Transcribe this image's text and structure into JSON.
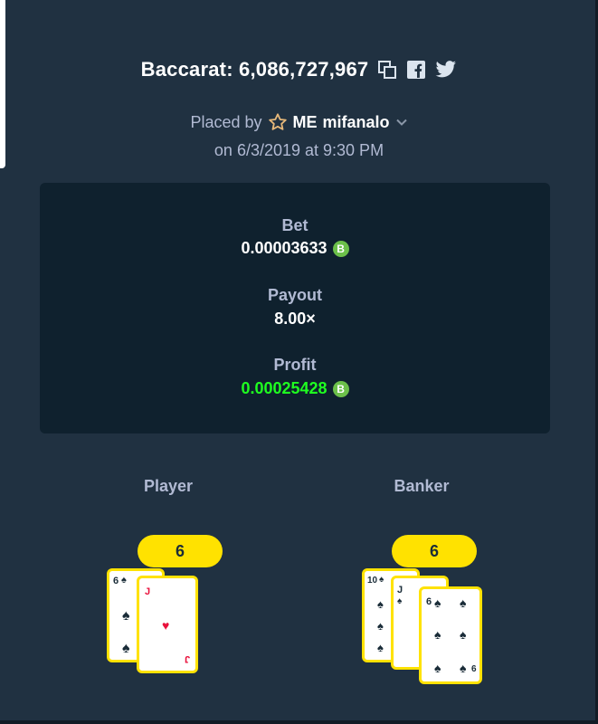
{
  "bet_info": {
    "title": "Baccarat: 6,086,727,967",
    "placed_by_label": "Placed by",
    "user_badge": "ME",
    "username": "mifanalo",
    "date_line": "on 6/3/2019 at 9:30 PM"
  },
  "stats": {
    "bet_label": "Bet",
    "bet_value": "0.00003633",
    "payout_label": "Payout",
    "payout_value": "8.00×",
    "profit_label": "Profit",
    "profit_value": "0.00025428",
    "coin_symbol": "B",
    "coin_color": "#6cc04a",
    "profit_color": "#1fff20"
  },
  "player": {
    "label": "Player",
    "score": "6",
    "cards": [
      {
        "rank": "6",
        "suit": "♠",
        "color": "black"
      },
      {
        "rank": "J",
        "suit": "♥",
        "color": "red"
      }
    ]
  },
  "banker": {
    "label": "Banker",
    "score": "6",
    "cards": [
      {
        "rank": "10",
        "suit": "♠",
        "color": "black"
      },
      {
        "rank": "J",
        "suit": "♠",
        "color": "black"
      },
      {
        "rank": "6",
        "suit": "♠",
        "color": "black"
      }
    ]
  },
  "icons": [
    "copy-icon",
    "facebook-icon",
    "twitter-icon",
    "star-icon",
    "chevron-down-icon",
    "bitcoin-icon"
  ],
  "colors": {
    "background": "#203141",
    "panel": "#0f212e",
    "accent_yellow": "#ffe200"
  }
}
